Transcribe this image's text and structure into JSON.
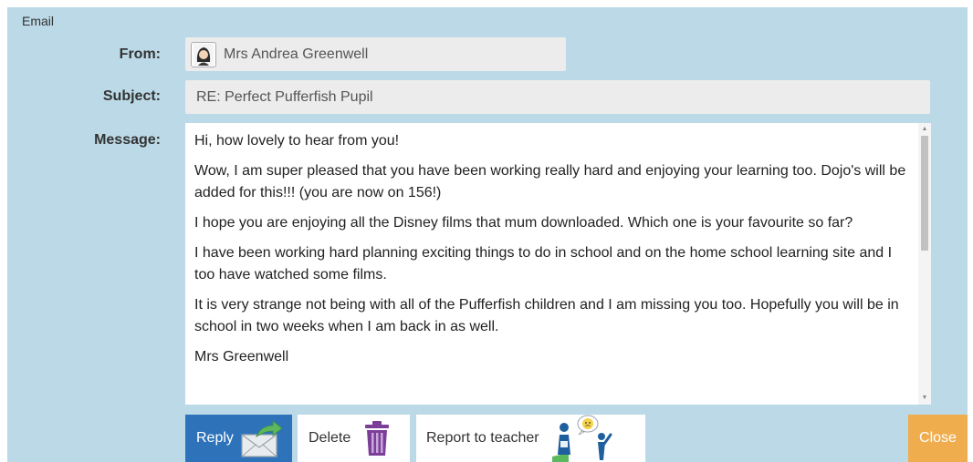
{
  "panel": {
    "title": "Email"
  },
  "from": {
    "label": "From:",
    "value": "Mrs Andrea Greenwell",
    "avatar_icon": "teacher-avatar-icon"
  },
  "subject": {
    "label": "Subject:",
    "value": "RE: Perfect Pufferfish Pupil"
  },
  "message": {
    "label": "Message:",
    "paragraphs": [
      "Hi, how lovely to hear from you!",
      "Wow, I am super pleased that you have been working really hard and enjoying your learning too. Dojo's will be added for this!!! (you are now on 156!)",
      "I hope you are enjoying all the Disney films that mum downloaded. Which one is your favourite so far?",
      "I have been working hard planning exciting things to do in school and on the home school learning site and I too have watched some films.",
      "It is very strange not being with all of the Pufferfish children and I am missing you too. Hopefully you will be in school in two weeks when I am back in as well.",
      "Mrs Greenwell"
    ]
  },
  "buttons": {
    "reply": "Reply",
    "delete": "Delete",
    "report": "Report to teacher",
    "close": "Close"
  },
  "colors": {
    "panel_bg": "#bbd9e6",
    "reply_bg": "#2e73ba",
    "close_bg": "#f0ad4e",
    "delete_icon": "#7b3f98",
    "reply_arrow": "#5cb85c"
  }
}
